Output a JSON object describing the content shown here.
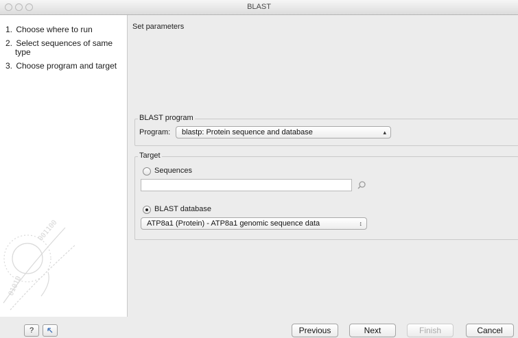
{
  "window": {
    "title": "BLAST"
  },
  "steps": [
    {
      "number": "1.",
      "label": "Choose where to run"
    },
    {
      "number": "2.",
      "label": "Select sequences of same",
      "label2": "type"
    },
    {
      "number": "3.",
      "label": "Choose program and target"
    }
  ],
  "main": {
    "title": "Set parameters",
    "blast_program": {
      "legend": "BLAST program",
      "program_label": "Program:",
      "program_value": "blastp: Protein sequence and database"
    },
    "target": {
      "legend": "Target",
      "sequences_label": "Sequences",
      "sequences_selected": false,
      "sequences_value": "",
      "database_label": "BLAST database",
      "database_selected": true,
      "database_value": "ATP8a1 (Protein) - ATP8a1 genomic sequence data"
    }
  },
  "footer": {
    "help_label": "?",
    "previous_label": "Previous",
    "next_label": "Next",
    "finish_label": "Finish",
    "cancel_label": "Cancel"
  },
  "icons": {
    "help": "help-icon",
    "restore": "restore-defaults-icon",
    "browse": "browse-icon",
    "select_arrows": "select-arrows-icon"
  }
}
